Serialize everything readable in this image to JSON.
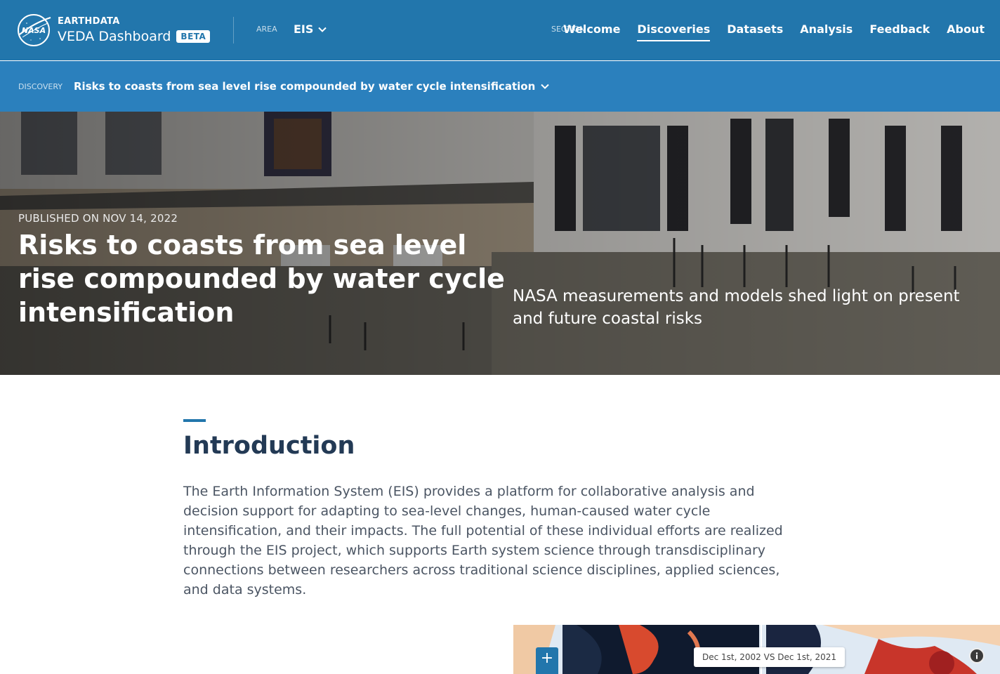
{
  "header": {
    "brand_top": "EARTHDATA",
    "brand_name": "VEDA Dashboard",
    "beta": "BETA",
    "area_label": "AREA",
    "area_value": "EIS",
    "section_label": "SECTION",
    "nav": [
      "Welcome",
      "Discoveries",
      "Datasets",
      "Analysis",
      "Feedback",
      "About"
    ],
    "active_nav": "Discoveries"
  },
  "subheader": {
    "label": "DISCOVERY",
    "value": "Risks to coasts from sea level rise compounded by water cycle intensification"
  },
  "hero": {
    "published": "PUBLISHED ON NOV 14, 2022",
    "title": "Risks to coasts from sea level rise compounded by water cycle intensification",
    "description": "NASA measurements and models shed light on present and future coastal risks"
  },
  "intro": {
    "heading": "Introduction",
    "paragraph": "The Earth Information System (EIS) provides a platform for collaborative analysis and decision support for adapting to sea-level changes, human-caused water cycle intensification, and their impacts. The full potential of these individual efforts are realized through the EIS project, which supports Earth system science through transdisciplinary connections between researchers across traditional science disciplines, applied sciences, and data systems."
  },
  "map": {
    "compare_label": "Dec 1st, 2002 VS Dec 1st, 2021",
    "zoom_in": "+"
  },
  "colors": {
    "header_bg": "#2276ac",
    "subheader_bg": "#2b80bd",
    "heading": "#233a55"
  },
  "icons": {
    "logo": "nasa-logo-icon",
    "chevron": "chevron-down-icon",
    "info": "info-icon"
  }
}
